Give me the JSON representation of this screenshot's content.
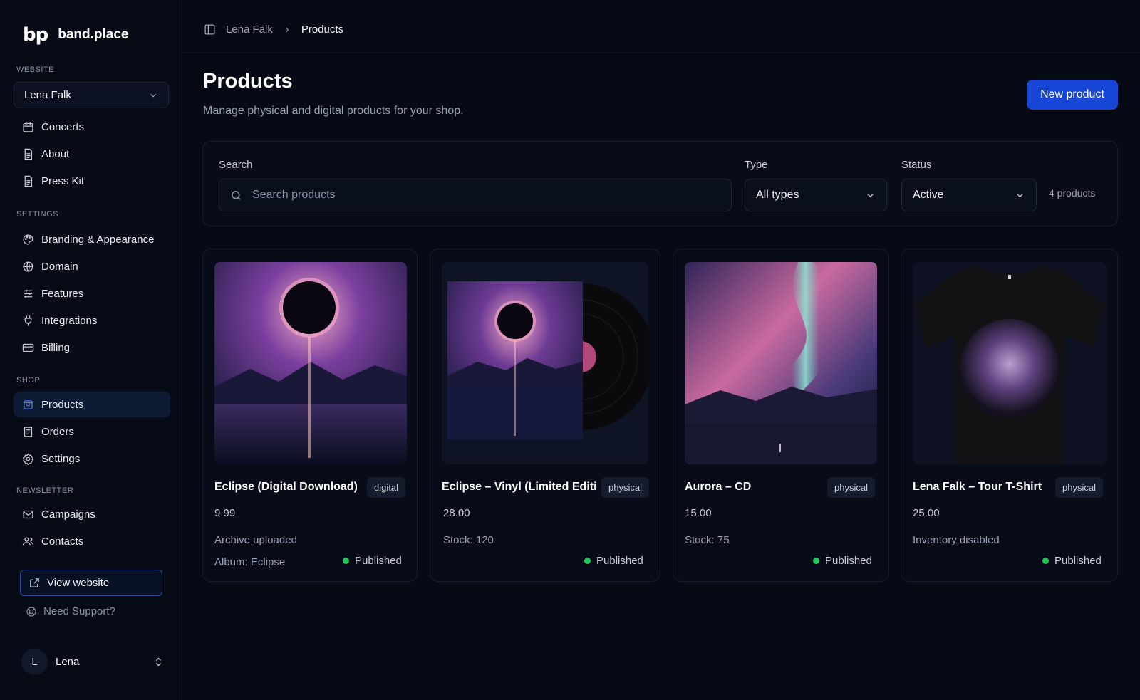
{
  "brand": {
    "logo": "bp",
    "name": "band.place"
  },
  "sidebar": {
    "website_label": "WEBSITE",
    "website_select": "Lena Falk",
    "website_items": [
      {
        "label": "Concerts",
        "icon": "calendar-icon"
      },
      {
        "label": "About",
        "icon": "document-icon"
      },
      {
        "label": "Press Kit",
        "icon": "document-icon"
      }
    ],
    "settings_label": "SETTINGS",
    "settings_items": [
      {
        "label": "Branding & Appearance",
        "icon": "palette-icon"
      },
      {
        "label": "Domain",
        "icon": "globe-icon"
      },
      {
        "label": "Features",
        "icon": "sliders-icon"
      },
      {
        "label": "Integrations",
        "icon": "plug-icon"
      },
      {
        "label": "Billing",
        "icon": "credit-card-icon"
      }
    ],
    "shop_label": "SHOP",
    "shop_items": [
      {
        "label": "Products",
        "icon": "shopping-bag-icon",
        "active": true
      },
      {
        "label": "Orders",
        "icon": "receipt-icon"
      },
      {
        "label": "Settings",
        "icon": "gear-icon"
      }
    ],
    "newsletter_label": "NEWSLETTER",
    "newsletter_items": [
      {
        "label": "Campaigns",
        "icon": "mail-icon"
      },
      {
        "label": "Contacts",
        "icon": "users-icon"
      }
    ],
    "view_website": "View website",
    "support": "Need Support?",
    "user": {
      "initial": "L",
      "name": "Lena"
    }
  },
  "breadcrumb": {
    "parent": "Lena Falk",
    "current": "Products"
  },
  "page": {
    "title": "Products",
    "subtitle": "Manage physical and digital products for your shop.",
    "new_button": "New product"
  },
  "filters": {
    "search_label": "Search",
    "search_placeholder": "Search products",
    "type_label": "Type",
    "type_value": "All types",
    "status_label": "Status",
    "status_value": "Active",
    "count": "4 products"
  },
  "products": [
    {
      "name": "Eclipse (Digital Download)",
      "badge": "digital",
      "price": "9.99",
      "meta1": "Archive uploaded",
      "meta2": "Album: Eclipse",
      "status": "Published"
    },
    {
      "name": "Eclipse – Vinyl (Limited Editic",
      "badge": "physical",
      "price": "28.00",
      "meta1": "Stock: 120",
      "meta2": "",
      "status": "Published"
    },
    {
      "name": "Aurora – CD",
      "badge": "physical",
      "price": "15.00",
      "meta1": "Stock: 75",
      "meta2": "",
      "status": "Published"
    },
    {
      "name": "Lena Falk – Tour T-Shirt",
      "badge": "physical",
      "price": "25.00",
      "meta1": "Inventory disabled",
      "meta2": "",
      "status": "Published"
    }
  ],
  "colors": {
    "accent": "#1745d6",
    "published": "#22c55e",
    "background": "#060a14"
  }
}
